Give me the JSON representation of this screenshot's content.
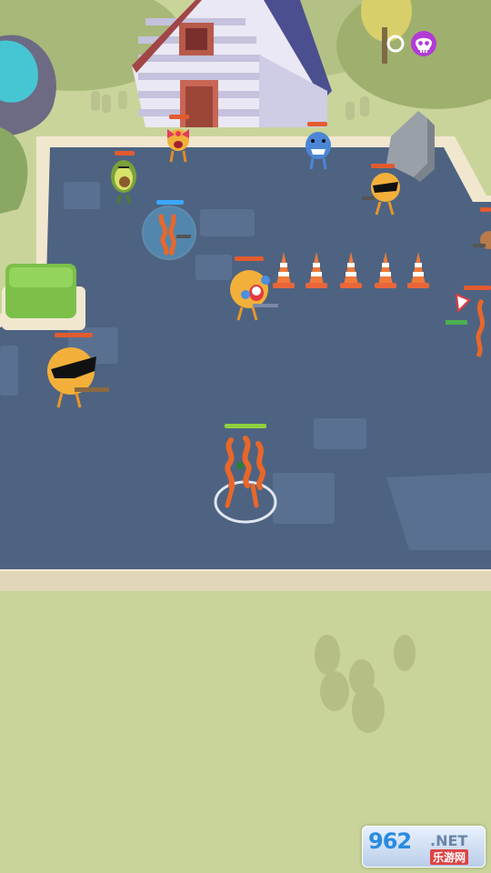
{
  "colors": {
    "arena_floor": "#4e6381",
    "arena_tile": "#5a7091",
    "arena_rim": "#f1e7cf",
    "grass": "#c9d49a",
    "player_hp": "#8fd13f",
    "enemy_hp": "#e25b2f",
    "shield_hp": "#3aa7ff",
    "kill_icon": "#b23bd6",
    "watermark_blue": "#2a8be0"
  },
  "hud": {
    "kill_counter_icon": "skull-icon",
    "kill_ring_icon": "ring-icon"
  },
  "player": {
    "name": "orange-rubber-hero",
    "health_fraction": 1.0
  },
  "enemies": [
    {
      "kind": "red-bow-girl",
      "health_fraction": 1.0
    },
    {
      "kind": "blue-shark",
      "health_fraction": 1.0
    },
    {
      "kind": "avocado",
      "health_fraction": 1.0
    },
    {
      "kind": "shielded-orange-rubber",
      "health_fraction": 1.0,
      "shield": true
    },
    {
      "kind": "sunglasses-orange",
      "health_fraction": 1.0
    },
    {
      "kind": "crying-orange",
      "health_fraction": 1.0
    },
    {
      "kind": "big-sunglasses-orange",
      "health_fraction": 1.0
    },
    {
      "kind": "rubber-sniper",
      "health_fraction": 1.0
    },
    {
      "kind": "edge-gunner",
      "health_fraction": 1.0
    }
  ],
  "props": {
    "cone_count": 5
  },
  "watermark": {
    "brand": "962",
    "suffix": ".NET",
    "sub": "乐游网"
  }
}
